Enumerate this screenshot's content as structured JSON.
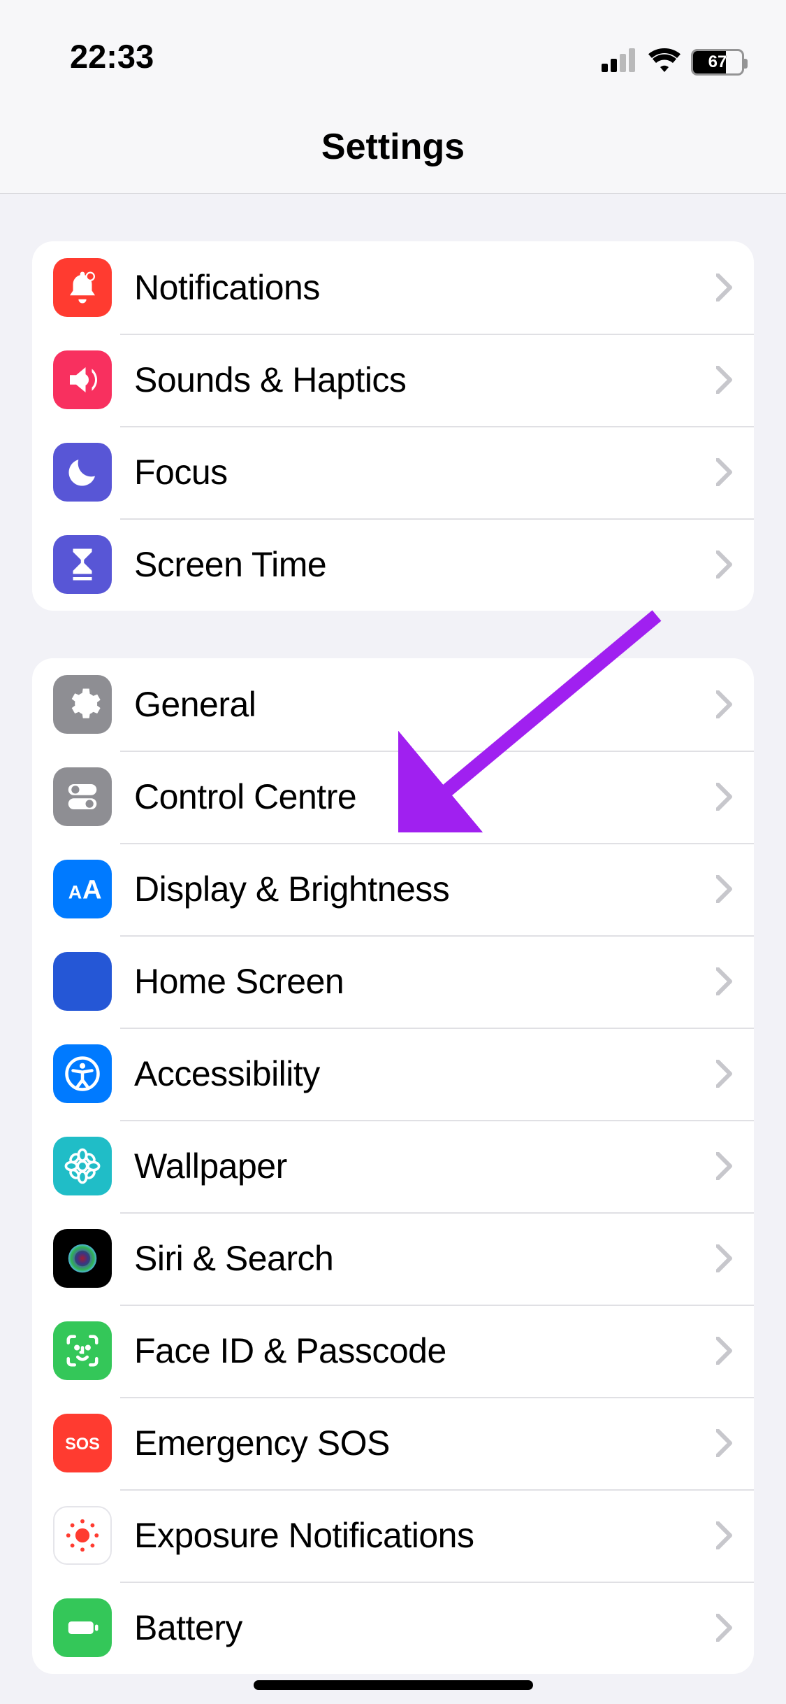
{
  "status": {
    "time": "22:33",
    "battery_pct": "67"
  },
  "header": {
    "title": "Settings"
  },
  "groups": [
    {
      "items": [
        {
          "id": "notifications",
          "label": "Notifications",
          "icon": "bell-icon",
          "bg": "ic-red"
        },
        {
          "id": "sounds",
          "label": "Sounds & Haptics",
          "icon": "speaker-icon",
          "bg": "ic-pink"
        },
        {
          "id": "focus",
          "label": "Focus",
          "icon": "moon-icon",
          "bg": "ic-indigo"
        },
        {
          "id": "screentime",
          "label": "Screen Time",
          "icon": "hourglass-icon",
          "bg": "ic-indigo"
        }
      ]
    },
    {
      "items": [
        {
          "id": "general",
          "label": "General",
          "icon": "gear-icon",
          "bg": "ic-gray"
        },
        {
          "id": "controlcentre",
          "label": "Control Centre",
          "icon": "switches-icon",
          "bg": "ic-gray"
        },
        {
          "id": "display",
          "label": "Display & Brightness",
          "icon": "textsize-icon",
          "bg": "ic-blue"
        },
        {
          "id": "homescreen",
          "label": "Home Screen",
          "icon": "apps-icon",
          "bg": "ic-apps"
        },
        {
          "id": "accessibility",
          "label": "Accessibility",
          "icon": "accessibility-icon",
          "bg": "ic-blue"
        },
        {
          "id": "wallpaper",
          "label": "Wallpaper",
          "icon": "flower-icon",
          "bg": "ic-cyan"
        },
        {
          "id": "siri",
          "label": "Siri & Search",
          "icon": "siri-icon",
          "bg": "ic-black"
        },
        {
          "id": "faceid",
          "label": "Face ID & Passcode",
          "icon": "faceid-icon",
          "bg": "ic-green"
        },
        {
          "id": "sos",
          "label": "Emergency SOS",
          "icon": "sos-icon",
          "bg": "ic-red"
        },
        {
          "id": "exposure",
          "label": "Exposure Notifications",
          "icon": "exposure-icon",
          "bg": "ic-white"
        },
        {
          "id": "battery",
          "label": "Battery",
          "icon": "battery-icon",
          "bg": "ic-green"
        }
      ]
    }
  ],
  "annotation": {
    "arrow_color": "#a020f0"
  }
}
